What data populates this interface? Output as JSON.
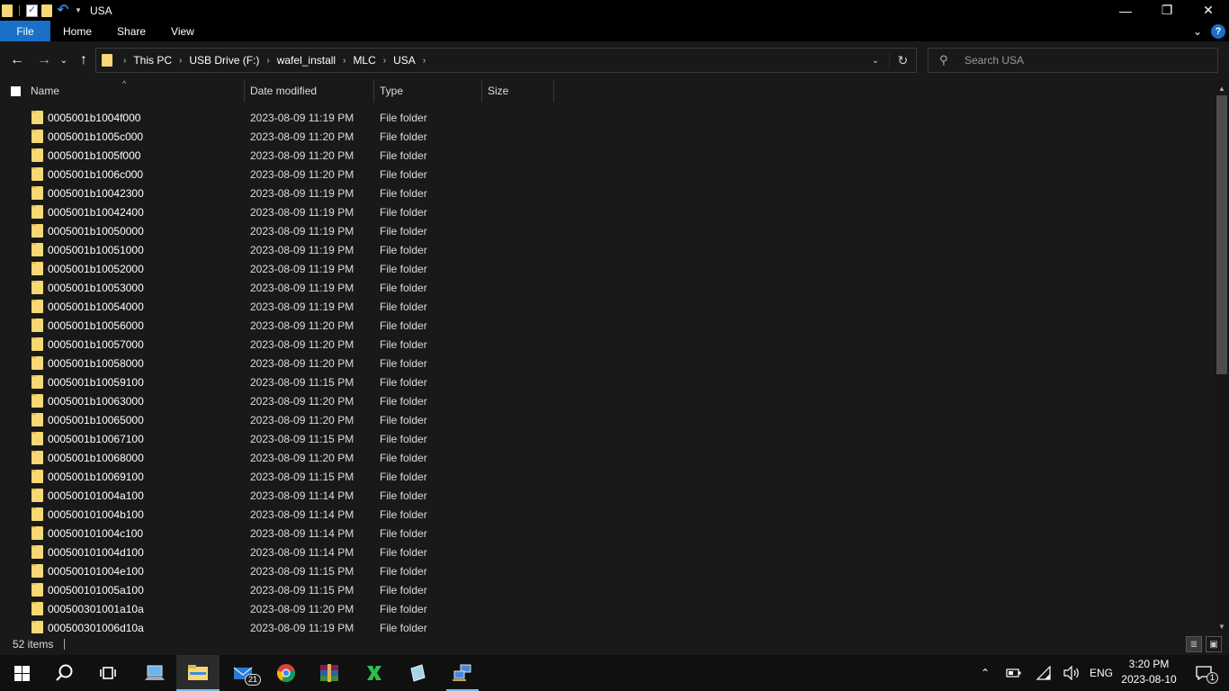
{
  "window": {
    "title": "USA",
    "controls": {
      "minimize": "—",
      "maximize": "❐",
      "close": "✕"
    }
  },
  "ribbon": {
    "tabs": [
      "File",
      "Home",
      "Share",
      "View"
    ],
    "help_icon": "?"
  },
  "address": {
    "crumbs": [
      "This PC",
      "USB Drive (F:)",
      "wafel_install",
      "MLC",
      "USA"
    ]
  },
  "search": {
    "placeholder": "Search USA"
  },
  "columns": {
    "name": "Name",
    "date": "Date modified",
    "type": "Type",
    "size": "Size"
  },
  "files": [
    {
      "name": "0005001b1004f000",
      "date": "2023-08-09 11:19 PM",
      "type": "File folder"
    },
    {
      "name": "0005001b1005c000",
      "date": "2023-08-09 11:20 PM",
      "type": "File folder"
    },
    {
      "name": "0005001b1005f000",
      "date": "2023-08-09 11:20 PM",
      "type": "File folder"
    },
    {
      "name": "0005001b1006c000",
      "date": "2023-08-09 11:20 PM",
      "type": "File folder"
    },
    {
      "name": "0005001b10042300",
      "date": "2023-08-09 11:19 PM",
      "type": "File folder"
    },
    {
      "name": "0005001b10042400",
      "date": "2023-08-09 11:19 PM",
      "type": "File folder"
    },
    {
      "name": "0005001b10050000",
      "date": "2023-08-09 11:19 PM",
      "type": "File folder"
    },
    {
      "name": "0005001b10051000",
      "date": "2023-08-09 11:19 PM",
      "type": "File folder"
    },
    {
      "name": "0005001b10052000",
      "date": "2023-08-09 11:19 PM",
      "type": "File folder"
    },
    {
      "name": "0005001b10053000",
      "date": "2023-08-09 11:19 PM",
      "type": "File folder"
    },
    {
      "name": "0005001b10054000",
      "date": "2023-08-09 11:19 PM",
      "type": "File folder"
    },
    {
      "name": "0005001b10056000",
      "date": "2023-08-09 11:20 PM",
      "type": "File folder"
    },
    {
      "name": "0005001b10057000",
      "date": "2023-08-09 11:20 PM",
      "type": "File folder"
    },
    {
      "name": "0005001b10058000",
      "date": "2023-08-09 11:20 PM",
      "type": "File folder"
    },
    {
      "name": "0005001b10059100",
      "date": "2023-08-09 11:15 PM",
      "type": "File folder"
    },
    {
      "name": "0005001b10063000",
      "date": "2023-08-09 11:20 PM",
      "type": "File folder"
    },
    {
      "name": "0005001b10065000",
      "date": "2023-08-09 11:20 PM",
      "type": "File folder"
    },
    {
      "name": "0005001b10067100",
      "date": "2023-08-09 11:15 PM",
      "type": "File folder"
    },
    {
      "name": "0005001b10068000",
      "date": "2023-08-09 11:20 PM",
      "type": "File folder"
    },
    {
      "name": "0005001b10069100",
      "date": "2023-08-09 11:15 PM",
      "type": "File folder"
    },
    {
      "name": "000500101004a100",
      "date": "2023-08-09 11:14 PM",
      "type": "File folder"
    },
    {
      "name": "000500101004b100",
      "date": "2023-08-09 11:14 PM",
      "type": "File folder"
    },
    {
      "name": "000500101004c100",
      "date": "2023-08-09 11:14 PM",
      "type": "File folder"
    },
    {
      "name": "000500101004d100",
      "date": "2023-08-09 11:14 PM",
      "type": "File folder"
    },
    {
      "name": "000500101004e100",
      "date": "2023-08-09 11:15 PM",
      "type": "File folder"
    },
    {
      "name": "000500101005a100",
      "date": "2023-08-09 11:15 PM",
      "type": "File folder"
    },
    {
      "name": "000500301001a10a",
      "date": "2023-08-09 11:20 PM",
      "type": "File folder"
    },
    {
      "name": "000500301006d10a",
      "date": "2023-08-09 11:19 PM",
      "type": "File folder"
    }
  ],
  "status": {
    "count": "52 items"
  },
  "taskbar": {
    "mail_badge": "21",
    "language": "ENG",
    "time": "3:20 PM",
    "date": "2023-08-10",
    "notification_badge": "1"
  },
  "colors": {
    "accent": "#1a6fc7",
    "folder": "#f8d775",
    "background": "#191919"
  }
}
